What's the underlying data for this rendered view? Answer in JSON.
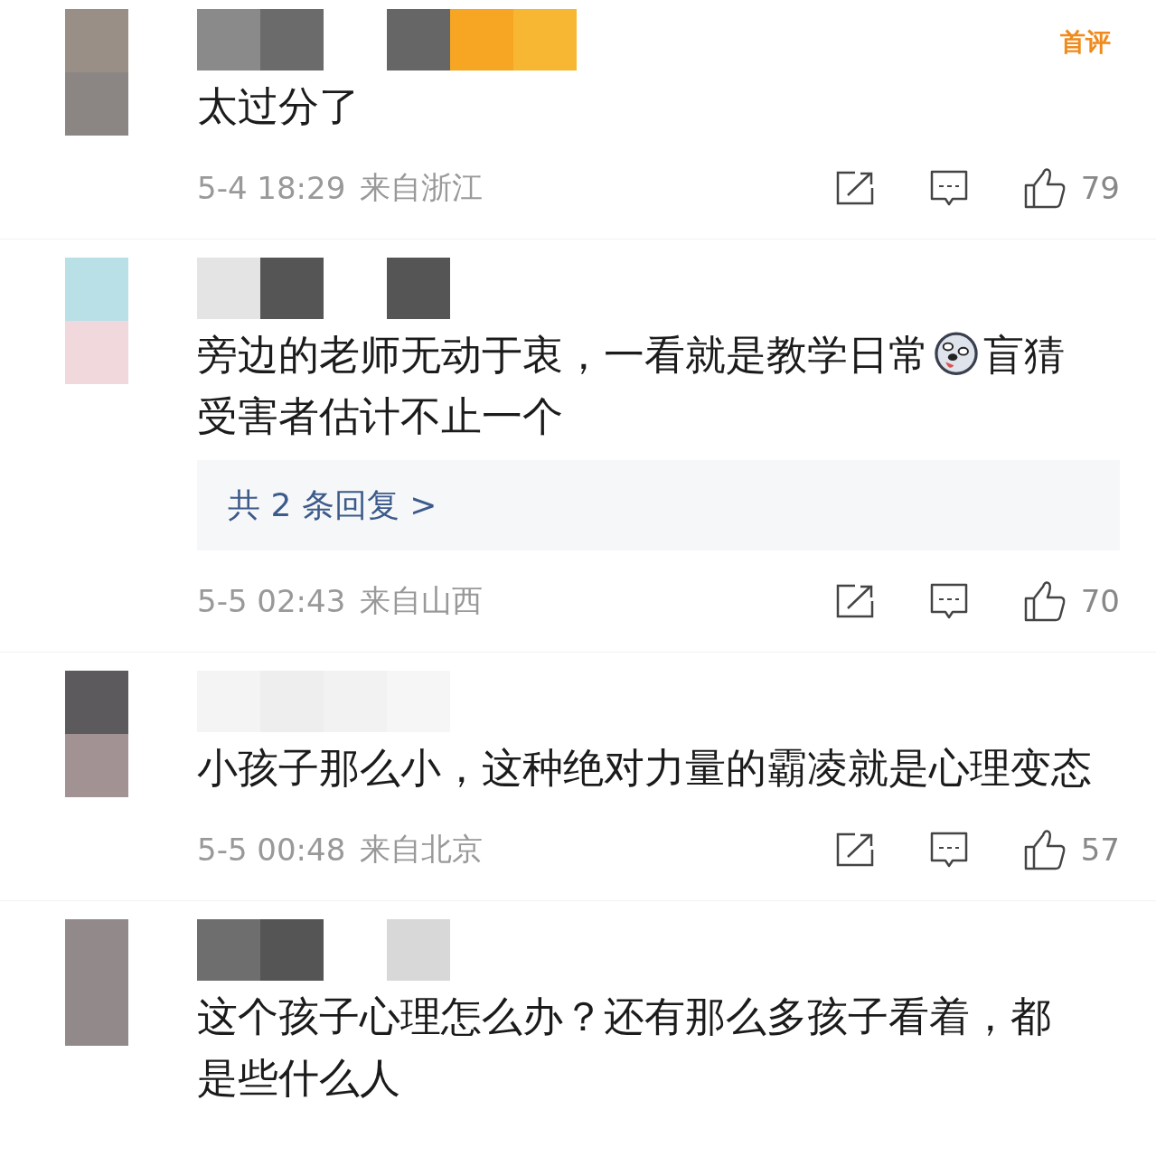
{
  "comments": [
    {
      "avatar": {
        "kind": "picture"
      },
      "name": {
        "kind": "picture"
      },
      "badge": "首评",
      "body": [
        {
          "kind": "text",
          "text": "太过分了"
        }
      ],
      "time": "5-4 18:29",
      "location": "来自浙江",
      "likes": "79"
    },
    {
      "avatar": {
        "kind": "picture"
      },
      "name": {
        "kind": "picture"
      },
      "body": [
        {
          "kind": "text",
          "text": "旁边的老师无动于衷，一看就是教学日常"
        },
        {
          "kind": "emoji"
        },
        {
          "kind": "text",
          "text": "盲猜"
        },
        {
          "kind": "text",
          "text": "受害者估计不止一个"
        }
      ],
      "replies": "共 2 条回复 >",
      "time": "5-5 02:43",
      "location": "来自山西",
      "likes": "70"
    },
    {
      "avatar": {
        "kind": "picture"
      },
      "name": {
        "kind": "picture"
      },
      "body": [
        {
          "kind": "text",
          "text": "小孩子那么小，这种绝对力量的霸凌就是心理变"
        },
        {
          "kind": "text",
          "text": "态"
        }
      ],
      "time": "5-5 00:48",
      "location": "来自北京",
      "likes": "57"
    },
    {
      "avatar": {
        "kind": "picture"
      },
      "name": {
        "kind": "picture"
      },
      "body": [
        {
          "kind": "text",
          "text": "这个孩子心理怎么办？还有那么多孩子看着，都"
        },
        {
          "kind": "text",
          "text": "是些什么人"
        }
      ]
    }
  ]
}
